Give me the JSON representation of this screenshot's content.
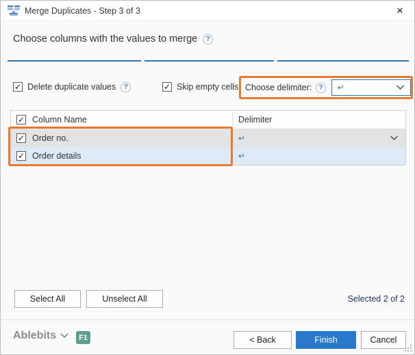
{
  "window": {
    "title": "Merge Duplicates - Step 3 of 3"
  },
  "icons": {
    "close": "✕",
    "help": "?",
    "checkmark": "✓"
  },
  "header": {
    "title": "Choose columns with the values to merge"
  },
  "steps": {
    "count": 3,
    "active_step": 3
  },
  "options": {
    "delete_duplicate_values": {
      "label": "Delete duplicate values",
      "checked": true
    },
    "skip_empty_cells": {
      "label": "Skip empty cells",
      "checked": true
    }
  },
  "delimiter_control": {
    "label": "Choose delimiter:",
    "value": "↵"
  },
  "table": {
    "header": {
      "name": "Column Name",
      "delimiter": "Delimiter"
    },
    "rows": [
      {
        "name": "Order no.",
        "delimiter": "↵",
        "checked": true
      },
      {
        "name": "Order details",
        "delimiter": "↵",
        "checked": true
      }
    ]
  },
  "selection": {
    "select_all": "Select All",
    "unselect_all": "Unselect All",
    "status": "Selected 2 of 2"
  },
  "footer": {
    "brand": "Ablebits",
    "help_badge": "F1",
    "back": "< Back",
    "finish": "Finish",
    "cancel": "Cancel"
  },
  "colors": {
    "accent_blue": "#2e75b6",
    "highlight_orange": "#e87a2f",
    "finish_button": "#2879cb",
    "badge_green": "#5f9e8f",
    "row_active_gray": "#e3e3e3",
    "row_selected_blue": "#dce9f7"
  }
}
